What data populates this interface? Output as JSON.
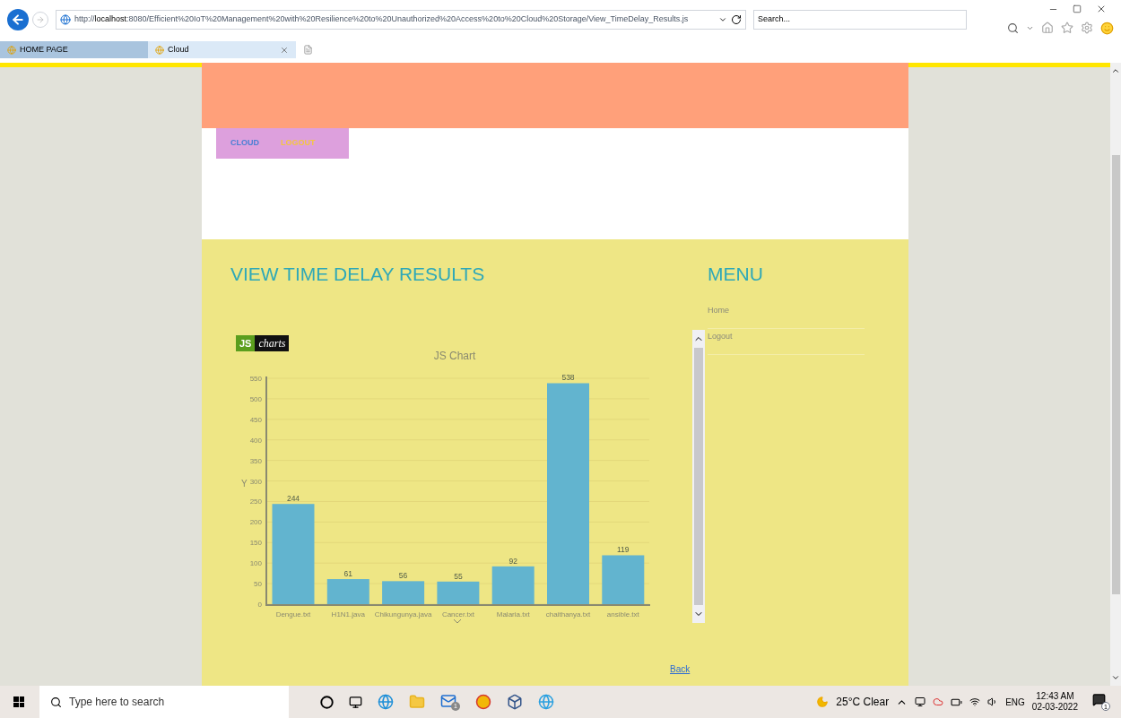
{
  "browser": {
    "url_prefix": "http://",
    "url_host": "localhost",
    "url_rest": ":8080/Efficient%20IoT%20Management%20with%20Resilience%20to%20Unauthorized%20Access%20to%20Cloud%20Storage/View_TimeDelay_Results.js",
    "search_placeholder": "Search...",
    "tabs": [
      {
        "label": "HOME PAGE",
        "selected": false
      },
      {
        "label": "Cloud",
        "selected": true
      }
    ]
  },
  "nav": [
    {
      "label": "CLOUD",
      "color": "#4a7fd4"
    },
    {
      "label": "LOGOUT",
      "color": "#f4c542"
    }
  ],
  "content": {
    "title": "VIEW TIME DELAY RESULTS",
    "logo_js": "JS",
    "logo_charts": "charts",
    "chart_data": {
      "type": "bar",
      "title": "JS Chart",
      "ylabel": "Y",
      "categories": [
        "Dengue.txt",
        "H1N1.java",
        "Chikungunya.java",
        "Cancer.txt",
        "Malaria.txt",
        "chaithanya.txt",
        "ansible.txt"
      ],
      "values": [
        244,
        61,
        56,
        55,
        92,
        538,
        119
      ],
      "ylim": [
        0,
        550
      ],
      "yticks": [
        0,
        50,
        100,
        150,
        200,
        250,
        300,
        350,
        400,
        450,
        500,
        550
      ],
      "data_labels": true,
      "grid": true
    },
    "back_link": "Back"
  },
  "menu": {
    "title": "MENU",
    "items": [
      "Home",
      "Logout"
    ]
  },
  "taskbar": {
    "search_placeholder": "Type here to search",
    "mail_badge": "1",
    "weather": "25°C Clear",
    "language": "ENG",
    "time": "12:43 AM",
    "date": "02-03-2022",
    "notification_badge": "1"
  }
}
